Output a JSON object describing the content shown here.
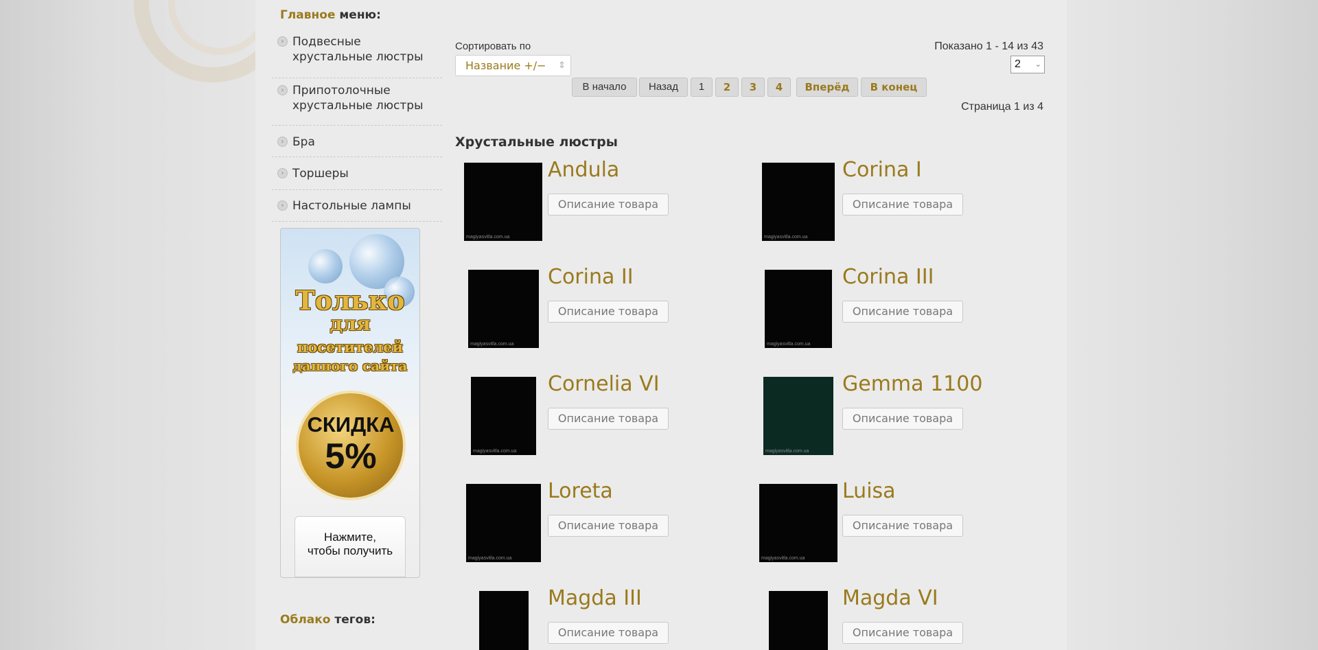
{
  "sidebar": {
    "title_accent": "Главное",
    "title_rest": " меню:",
    "items": [
      {
        "label": "Подвесные хрустальные люстры"
      },
      {
        "label": "Припотолочные хрустальные люстры"
      },
      {
        "label": "Бра"
      },
      {
        "label": "Торшеры"
      },
      {
        "label": "Настольные лампы"
      }
    ],
    "tags_accent": "Облако",
    "tags_rest": " тегов:"
  },
  "banner": {
    "line1": "Только",
    "line2": "для",
    "line3": "посетителей",
    "line4": "данного сайта",
    "discount_label": "СКИДКА",
    "discount_value": "5%",
    "button_line1": "Нажмите,",
    "button_line2": "чтобы получить"
  },
  "toolbar": {
    "sort_label": "Сортировать по",
    "sort_value": "Название +/−",
    "shown": "Показано 1 - 14 из 43",
    "limit_value": "2",
    "page_of": "Страница 1 из 4"
  },
  "pagination": {
    "first": "В начало",
    "prev": "Назад",
    "pages": [
      "1",
      "2",
      "3",
      "4"
    ],
    "next": "Вперёд",
    "last": "В конец"
  },
  "category": {
    "title": "Хрустальные люстры"
  },
  "products": [
    {
      "name": "Andula",
      "button": "Описание товара"
    },
    {
      "name": "Corina I",
      "button": "Описание товара"
    },
    {
      "name": "Corina II",
      "button": "Описание товара"
    },
    {
      "name": "Corina III",
      "button": "Описание товара"
    },
    {
      "name": "Cornelia VI",
      "button": "Описание товара"
    },
    {
      "name": "Gemma 1100",
      "button": "Описание товара"
    },
    {
      "name": "Loreta",
      "button": "Описание товара"
    },
    {
      "name": "Luisa",
      "button": "Описание товара"
    },
    {
      "name": "Magda III",
      "button": "Описание товара"
    },
    {
      "name": "Magda VI",
      "button": "Описание товара"
    }
  ],
  "colors": {
    "accent": "#9a7a1d",
    "page_bg": "#ebebeb"
  }
}
